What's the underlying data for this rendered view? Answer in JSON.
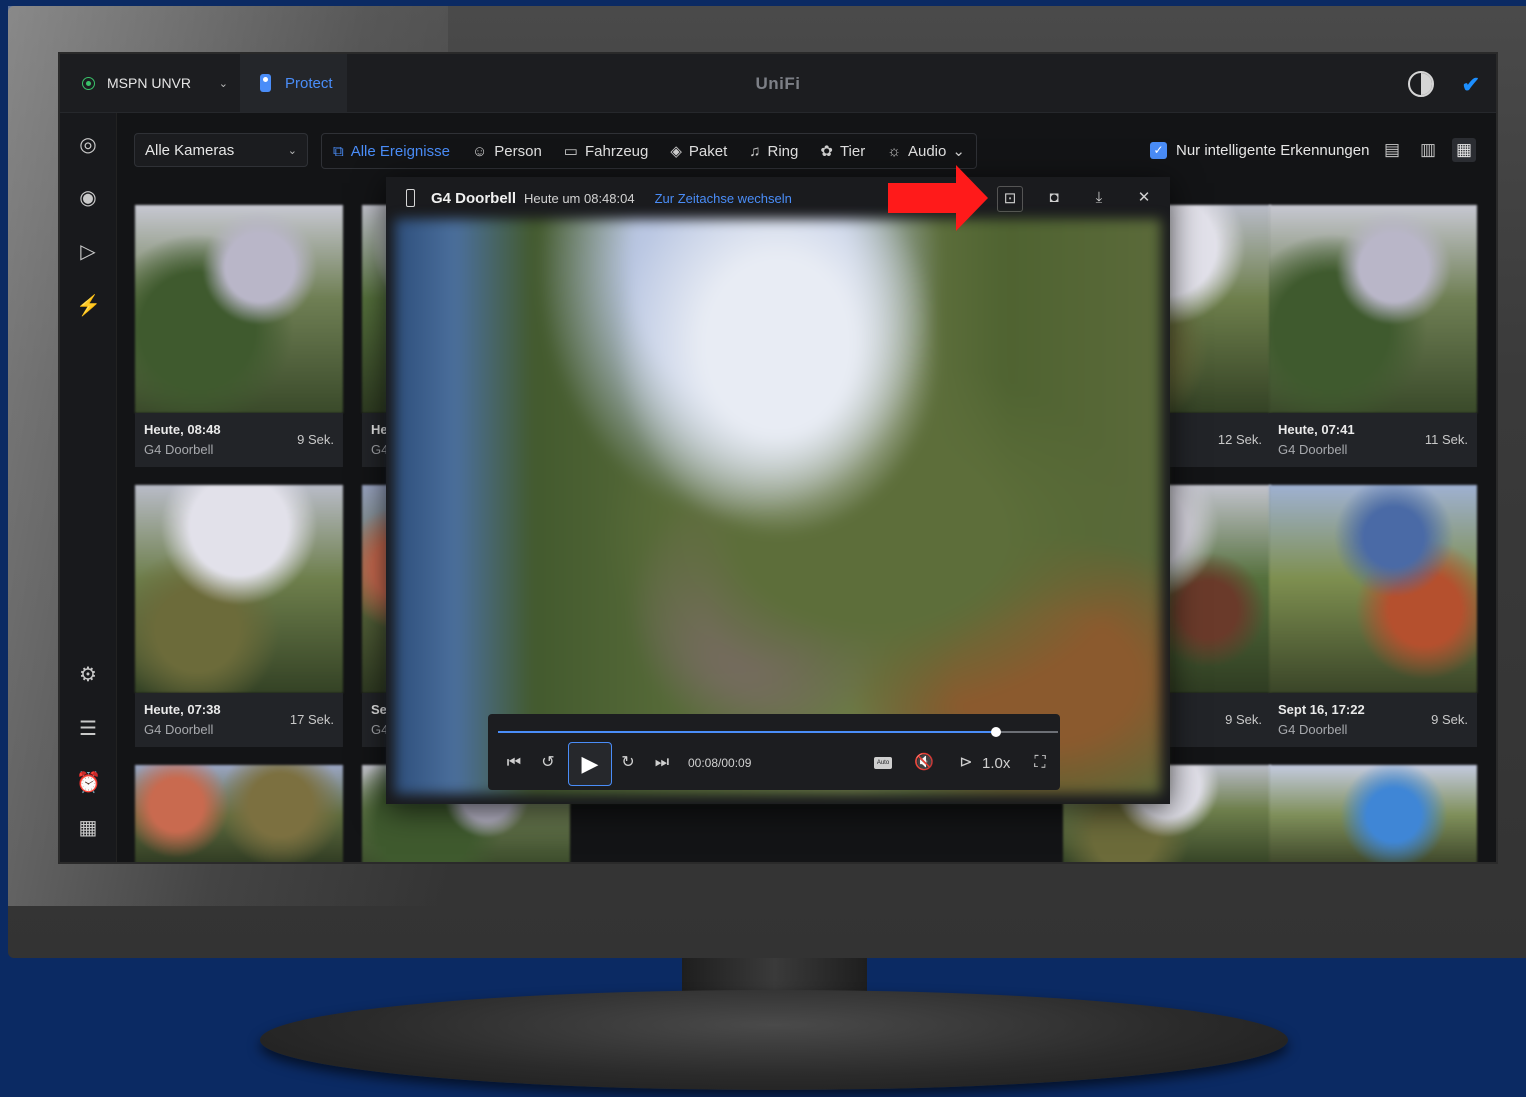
{
  "topbar": {
    "site_name": "MSPN UNVR",
    "app_name": "Protect",
    "brand": "UniFi"
  },
  "filters": {
    "camera_select": "Alle Kameras",
    "chips": [
      {
        "label": "Alle Ereignisse",
        "icon": "all-events-icon",
        "active": true
      },
      {
        "label": "Person",
        "icon": "person-icon",
        "active": false
      },
      {
        "label": "Fahrzeug",
        "icon": "vehicle-icon",
        "active": false
      },
      {
        "label": "Paket",
        "icon": "package-icon",
        "active": false
      },
      {
        "label": "Ring",
        "icon": "bell-icon",
        "active": false
      },
      {
        "label": "Tier",
        "icon": "paw-icon",
        "active": false
      },
      {
        "label": "Audio",
        "icon": "alarm-icon",
        "active": false
      }
    ],
    "smart_only_label": "Nur intelligente Erkennungen",
    "smart_only_checked": true
  },
  "events": [
    {
      "time": "Heute, 08:48",
      "camera": "G4 Doorbell",
      "duration": "9 Sek."
    },
    {
      "time": "He",
      "camera": "G4",
      "duration": ""
    },
    {
      "time": "",
      "camera": "",
      "duration": "12 Sek."
    },
    {
      "time": "Heute, 07:41",
      "camera": "G4 Doorbell",
      "duration": "11 Sek."
    },
    {
      "time": "Heute, 07:38",
      "camera": "G4 Doorbell",
      "duration": "17 Sek."
    },
    {
      "time": "Se",
      "camera": "G4",
      "duration": ""
    },
    {
      "time": "",
      "camera": "",
      "duration": "9 Sek."
    },
    {
      "time": "Sept 16, 17:22",
      "camera": "G4 Doorbell",
      "duration": "9 Sek."
    }
  ],
  "player": {
    "camera": "G4 Doorbell",
    "timestamp": "Heute um 08:48:04",
    "timeline_link": "Zur Zeitachse wechseln",
    "time_readout": "00:08/00:09",
    "progress": 0.89,
    "speed": "1.0x",
    "quality_badge": "Auto"
  },
  "colors": {
    "accent": "#4a8df8",
    "annotation_arrow": "#ff1a1a",
    "background": "#0b2a63"
  }
}
